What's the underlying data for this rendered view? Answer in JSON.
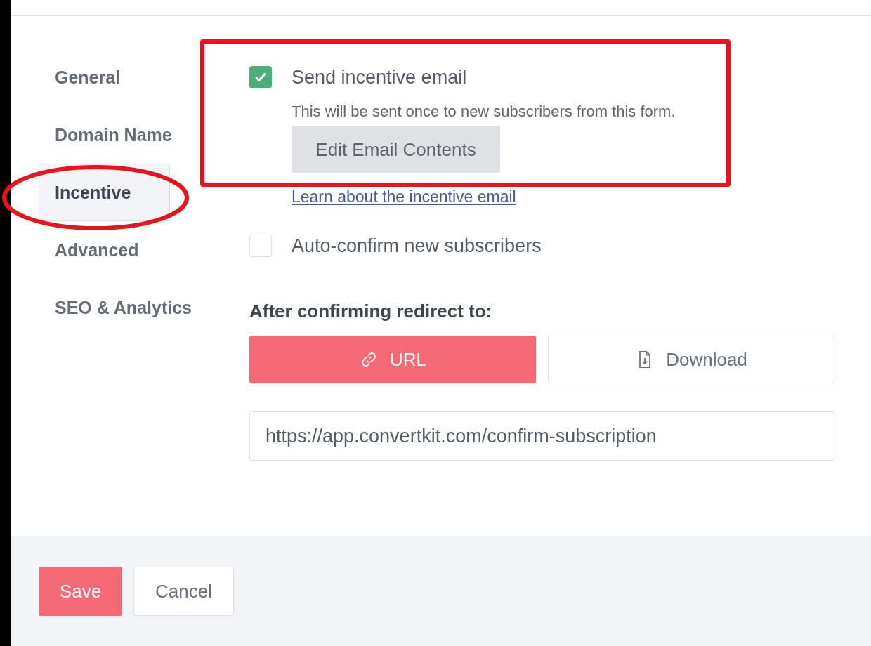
{
  "nav": {
    "items": [
      {
        "label": "General",
        "selected": false,
        "circled": false
      },
      {
        "label": "Domain Name",
        "selected": false,
        "circled": false
      },
      {
        "label": "Incentive",
        "selected": true,
        "circled": true
      },
      {
        "label": "Advanced",
        "selected": false,
        "circled": false
      },
      {
        "label": "SEO & Analytics",
        "selected": false,
        "circled": false
      }
    ]
  },
  "incentive": {
    "boxed": true,
    "checkbox": {
      "label": "Send incentive email",
      "checked": true
    },
    "description": "This will be sent once to new subscribers from this form.",
    "edit_button": "Edit Email Contents"
  },
  "learn_link": "Learn about the incentive email",
  "auto_confirm": {
    "label": "Auto-confirm new subscribers",
    "checked": false
  },
  "redirect": {
    "heading": "After confirming redirect to:",
    "options": [
      {
        "label": "URL",
        "kind": "url",
        "selected": true
      },
      {
        "label": "Download",
        "kind": "download",
        "selected": false
      }
    ],
    "url": "https://app.convertkit.com/confirm-subscription"
  },
  "footer": {
    "save": "Save",
    "cancel": "Cancel"
  }
}
